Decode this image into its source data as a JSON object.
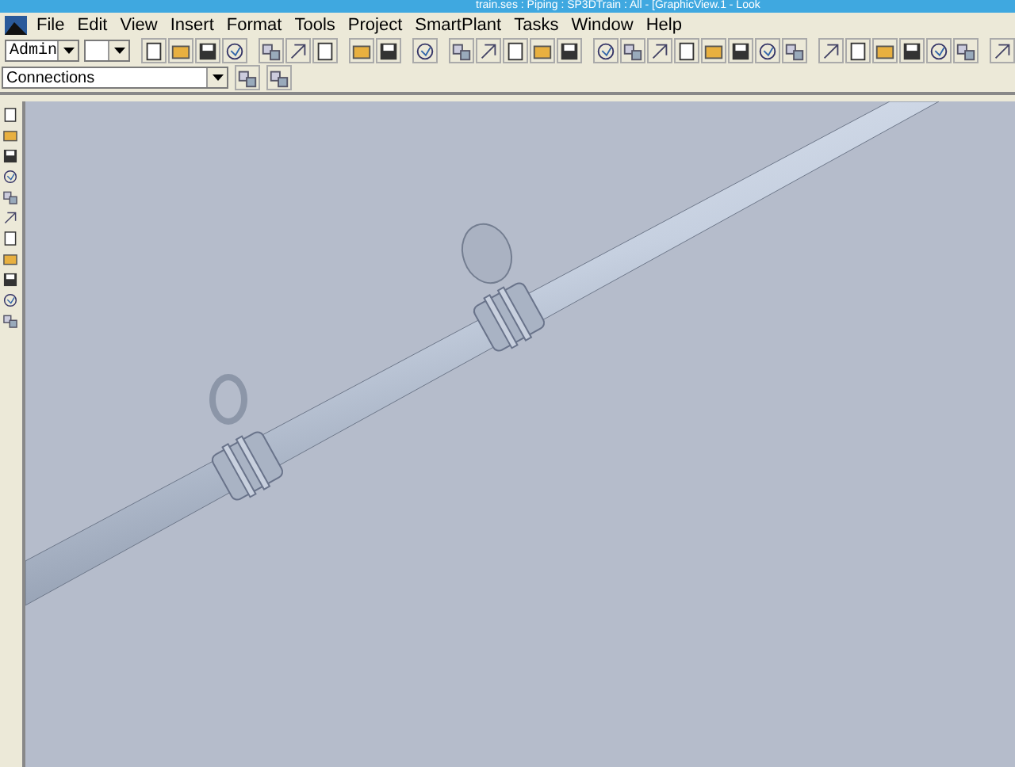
{
  "window": {
    "title": "train.ses : Piping : SP3DTrain : All - [GraphicView.1 - Look"
  },
  "menu": [
    "File",
    "Edit",
    "View",
    "Insert",
    "Format",
    "Tools",
    "Project",
    "SmartPlant",
    "Tasks",
    "Window",
    "Help"
  ],
  "toolbar": {
    "permission_group": {
      "value": "Admin"
    }
  },
  "locate_filter": {
    "value": "Connections"
  }
}
